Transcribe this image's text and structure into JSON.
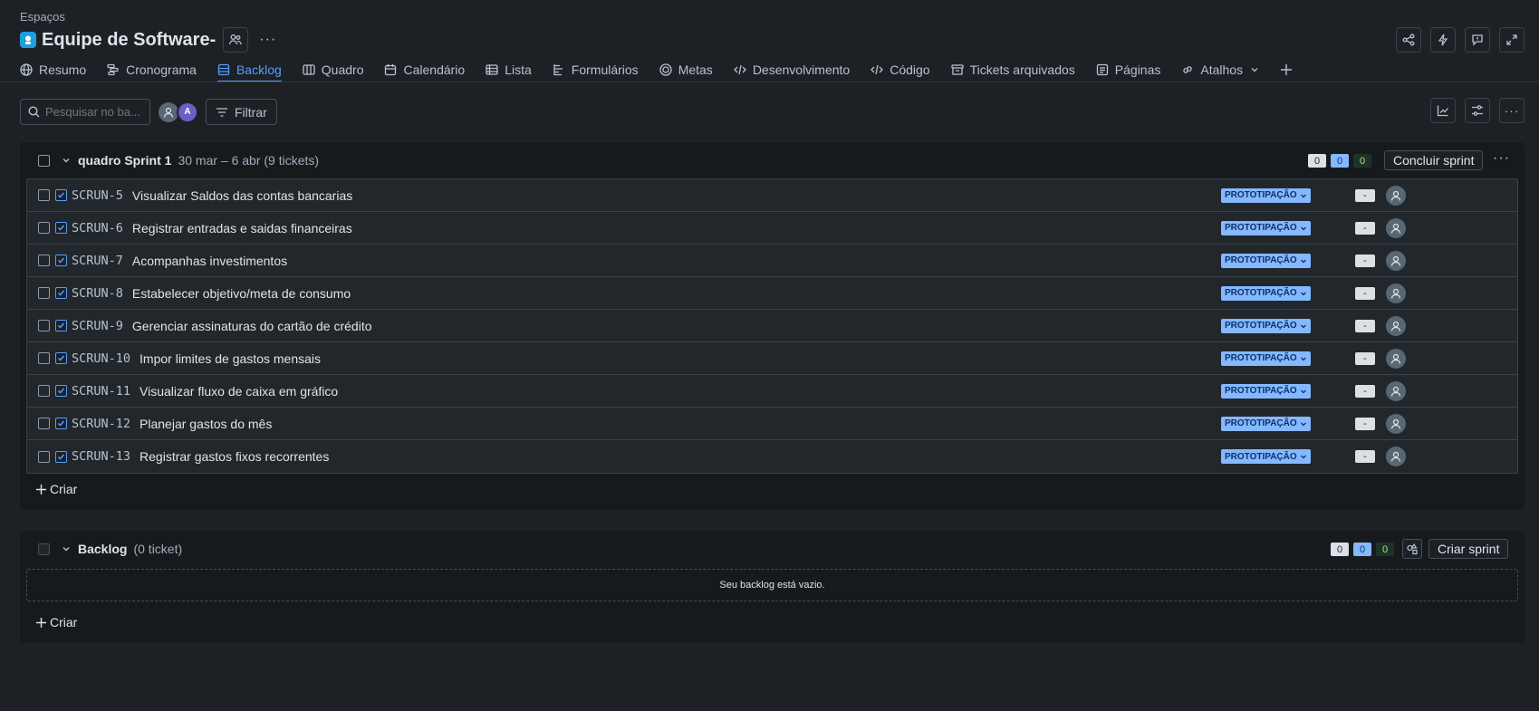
{
  "breadcrumb": "Espaços",
  "project": {
    "title": "Equipe de Software-"
  },
  "nav": [
    {
      "label": "Resumo",
      "icon": "globe-icon",
      "active": false
    },
    {
      "label": "Cronograma",
      "icon": "timeline-icon",
      "active": false
    },
    {
      "label": "Backlog",
      "icon": "backlog-icon",
      "active": true
    },
    {
      "label": "Quadro",
      "icon": "board-icon",
      "active": false
    },
    {
      "label": "Calendário",
      "icon": "calendar-icon",
      "active": false
    },
    {
      "label": "Lista",
      "icon": "list-icon",
      "active": false
    },
    {
      "label": "Formulários",
      "icon": "forms-icon",
      "active": false
    },
    {
      "label": "Metas",
      "icon": "target-icon",
      "active": false
    },
    {
      "label": "Desenvolvimento",
      "icon": "code-icon",
      "active": false
    },
    {
      "label": "Código",
      "icon": "code-icon",
      "active": false
    },
    {
      "label": "Tickets arquivados",
      "icon": "archive-icon",
      "active": false
    },
    {
      "label": "Páginas",
      "icon": "pages-icon",
      "active": false
    },
    {
      "label": "Atalhos",
      "icon": "link-icon",
      "active": false
    }
  ],
  "toolbar": {
    "search_placeholder": "Pesquisar no ba...",
    "avatar_initial": "A",
    "filter_label": "Filtrar"
  },
  "sprint": {
    "title": "quadro Sprint 1",
    "subtitle": "30 mar – 6 abr (9 tickets)",
    "counts": [
      "0",
      "0",
      "0"
    ],
    "complete_label": "Concluir sprint",
    "create_label": "Criar",
    "issues": [
      {
        "key": "SCRUN-5",
        "summary": "Visualizar Saldos das contas bancarias",
        "status": "PROTOTIPAÇÃO",
        "estimate": "-"
      },
      {
        "key": "SCRUN-6",
        "summary": "Registrar entradas e saidas financeiras",
        "status": "PROTOTIPAÇÃO",
        "estimate": "-"
      },
      {
        "key": "SCRUN-7",
        "summary": "Acompanhas investimentos",
        "status": "PROTOTIPAÇÃO",
        "estimate": "-"
      },
      {
        "key": "SCRUN-8",
        "summary": "Estabelecer objetivo/meta de consumo",
        "status": "PROTOTIPAÇÃO",
        "estimate": "-"
      },
      {
        "key": "SCRUN-9",
        "summary": "Gerenciar assinaturas do cartão de crédito",
        "status": "PROTOTIPAÇÃO",
        "estimate": "-"
      },
      {
        "key": "SCRUN-10",
        "summary": "Impor limites de gastos mensais",
        "status": "PROTOTIPAÇÃO",
        "estimate": "-"
      },
      {
        "key": "SCRUN-11",
        "summary": "Visualizar fluxo de caixa em gráfico",
        "status": "PROTOTIPAÇÃO",
        "estimate": "-"
      },
      {
        "key": "SCRUN-12",
        "summary": "Planejar gastos do mês",
        "status": "PROTOTIPAÇÃO",
        "estimate": "-"
      },
      {
        "key": "SCRUN-13",
        "summary": "Registrar gastos fixos recorrentes",
        "status": "PROTOTIPAÇÃO",
        "estimate": "-"
      }
    ]
  },
  "backlog": {
    "title": "Backlog",
    "subtitle": "(0 ticket)",
    "counts": [
      "0",
      "0",
      "0"
    ],
    "create_sprint_label": "Criar sprint",
    "empty_text": "Seu backlog está vazio.",
    "create_label": "Criar"
  },
  "colors": {
    "background": "#1d2125",
    "accent": "#579dff",
    "status": "#85b8ff"
  }
}
